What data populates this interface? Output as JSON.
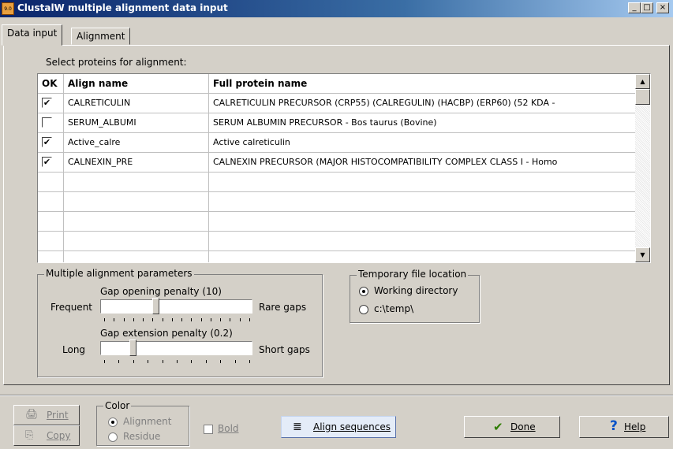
{
  "window": {
    "title": "ClustalW multiple alignment data input",
    "app_icon_text": "9.0",
    "minimize": "_",
    "maximize": "□",
    "close": "×"
  },
  "tabs": [
    {
      "label": "Data input"
    },
    {
      "label": "Alignment"
    }
  ],
  "proteins": {
    "section_label": "Select proteins for alignment:",
    "columns": {
      "ok": "OK",
      "align_name": "Align name",
      "full_name": "Full protein name"
    },
    "rows": [
      {
        "checked": true,
        "align_name": "CALRETICULIN",
        "full_name": "CALRETICULIN PRECURSOR (CRP55) (CALREGULIN) (HACBP) (ERP60) (52 KDA -"
      },
      {
        "checked": false,
        "align_name": "SERUM_ALBUMI",
        "full_name": "SERUM ALBUMIN PRECURSOR - Bos taurus (Bovine)"
      },
      {
        "checked": true,
        "align_name": "Active_calre",
        "full_name": "Active calreticulin"
      },
      {
        "checked": true,
        "align_name": "CALNEXIN_PRE",
        "full_name": "CALNEXIN PRECURSOR (MAJOR HISTOCOMPATIBILITY COMPLEX CLASS I - Homo"
      }
    ],
    "check_mark": "✔"
  },
  "params": {
    "title": "Multiple alignment parameters",
    "gap_open": {
      "label": "Gap opening penalty (10)",
      "left": "Frequent",
      "right": "Rare gaps",
      "level": 0.36
    },
    "gap_ext": {
      "label": "Gap extension penalty (0.2)",
      "left": "Long",
      "right": "Short gaps",
      "level": 0.2
    }
  },
  "temp": {
    "title": "Temporary file location",
    "options": [
      {
        "label": "Working directory",
        "selected": true
      },
      {
        "label": "c:\\temp\\",
        "selected": false
      }
    ]
  },
  "bottom": {
    "print": "Print",
    "copy": "Copy",
    "color_title": "Color",
    "color_options": [
      {
        "label": "Alignment",
        "selected": true
      },
      {
        "label": "Residue",
        "selected": false
      }
    ],
    "bold": "Bold",
    "align_sequences": "Align sequences",
    "done": "Done",
    "help": "Help"
  },
  "colors": {
    "title_start": "#0a246a",
    "title_end": "#a6caf0",
    "done_check": "#2e7d00",
    "help_q": "#0050c8",
    "face": "#d4d0c8"
  }
}
